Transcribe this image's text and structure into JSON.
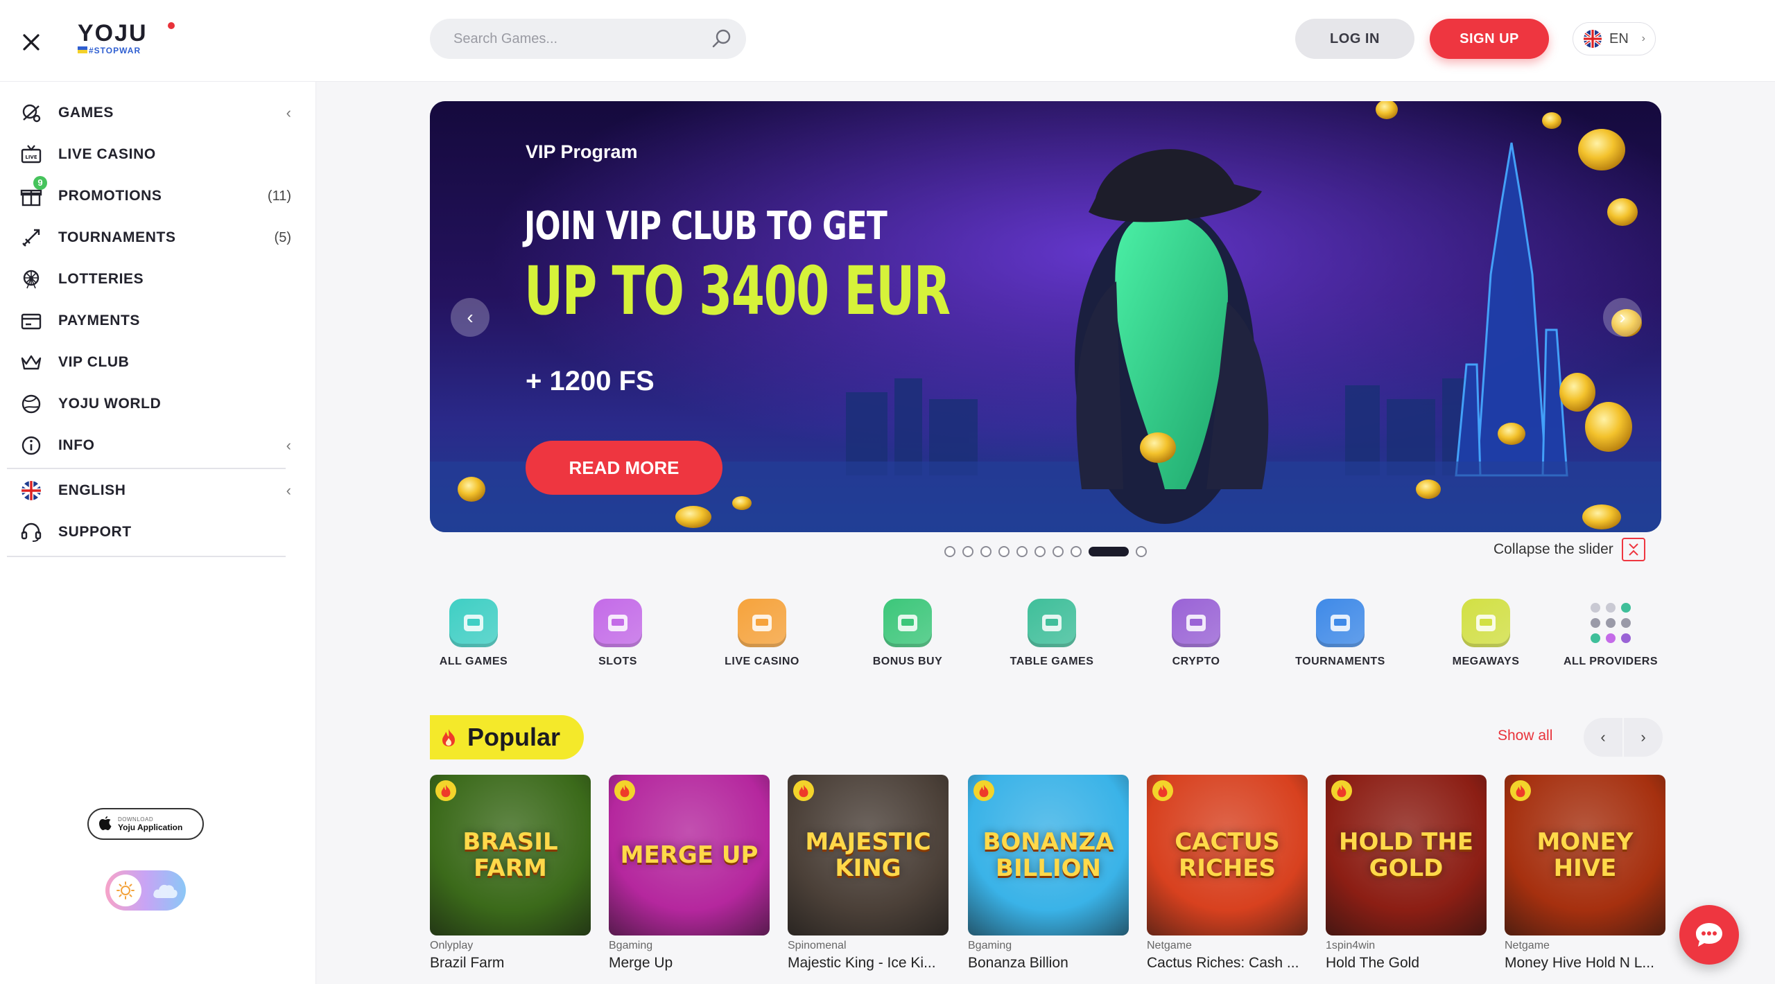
{
  "header": {
    "logo_text": "YOJU",
    "logo_tag": "#STOPWAR",
    "search_placeholder": "Search Games...",
    "login_label": "LOG IN",
    "signup_label": "SIGN UP",
    "lang_label": "EN"
  },
  "sidebar": {
    "items": [
      {
        "label": "GAMES"
      },
      {
        "label": "LIVE CASINO"
      },
      {
        "label": "PROMOTIONS",
        "count": "(11)",
        "badge": "9"
      },
      {
        "label": "TOURNAMENTS",
        "count": "(5)"
      },
      {
        "label": "LOTTERIES"
      },
      {
        "label": "PAYMENTS"
      },
      {
        "label": "VIP CLUB"
      },
      {
        "label": "YOJU WORLD"
      },
      {
        "label": "INFO"
      },
      {
        "label": "ENGLISH"
      },
      {
        "label": "SUPPORT"
      }
    ],
    "app_small": "DOWNLOAD",
    "app_label": "Yoju Application"
  },
  "banner": {
    "eyebrow": "VIP Program",
    "headline": "JOIN VIP CLUB TO GET",
    "highlight": "UP TO 3400 EUR",
    "free_spins": "+ 1200 FS",
    "cta": "READ MORE",
    "slide_count": 10,
    "active_slide": 9,
    "collapse_label": "Collapse the slider"
  },
  "categories": [
    {
      "label": "ALL GAMES",
      "icon": "bar-machine-icon",
      "color": "#3fcfc4"
    },
    {
      "label": "SLOTS",
      "icon": "slot-icon",
      "color": "#c46be8"
    },
    {
      "label": "LIVE CASINO",
      "icon": "live-icon",
      "color": "#f6a33c"
    },
    {
      "label": "BONUS BUY",
      "icon": "diamond-icon",
      "color": "#3cc77a"
    },
    {
      "label": "TABLE GAMES",
      "icon": "cards-icon",
      "color": "#3fbf9a"
    },
    {
      "label": "CRYPTO",
      "icon": "bitcoin-icon",
      "color": "#9a63d6"
    },
    {
      "label": "TOURNAMENTS",
      "icon": "tournament-icon",
      "color": "#3f8ae8"
    },
    {
      "label": "MEGAWAYS",
      "icon": "megaways-icon",
      "color": "#d2e044"
    },
    {
      "label": "ALL PROVIDERS",
      "icon": "grid-dots-icon",
      "color": "#8e8ea8"
    }
  ],
  "popular": {
    "title": "Popular",
    "show_all": "Show all",
    "games": [
      {
        "provider": "Onlyplay",
        "name": "Brazil Farm",
        "art": "BRASIL FARM",
        "bg": "#3b6a1a"
      },
      {
        "provider": "Bgaming",
        "name": "Merge Up",
        "art": "MERGE UP",
        "bg": "#b5279e"
      },
      {
        "provider": "Spinomenal",
        "name": "Majestic King - Ice Ki...",
        "art": "MAJESTIC KING",
        "bg": "#4b4038"
      },
      {
        "provider": "Bgaming",
        "name": "Bonanza Billion",
        "art": "BONANZA BILLION",
        "bg": "#3ab3e8"
      },
      {
        "provider": "Netgame",
        "name": "Cactus Riches: Cash ...",
        "art": "CACTUS RICHES",
        "bg": "#d8411f"
      },
      {
        "provider": "1spin4win",
        "name": "Hold The Gold",
        "art": "HOLD THE GOLD",
        "bg": "#8c1e14"
      },
      {
        "provider": "Netgame",
        "name": "Money Hive Hold N L...",
        "art": "MONEY HIVE",
        "bg": "#a6300f"
      }
    ]
  },
  "colors": {
    "accent": "#ee3640",
    "highlight": "#d6f23a",
    "popular_bg": "#f4e92a"
  }
}
